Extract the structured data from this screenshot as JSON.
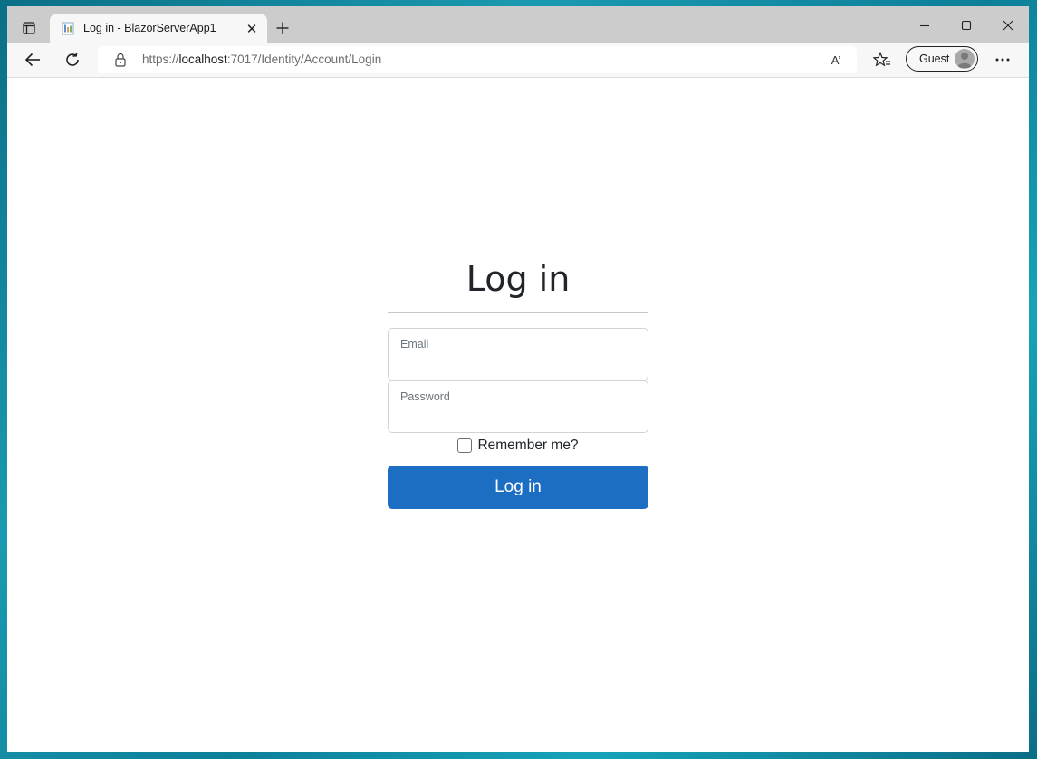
{
  "browser": {
    "tab_title": "Log in - BlazorServerApp1",
    "url_prefix": "https://",
    "url_host": "localhost",
    "url_rest": ":7017/Identity/Account/Login",
    "profile_label": "Guest",
    "tab_close_glyph": "✕",
    "readaloud_glyph": "A’"
  },
  "login": {
    "title": "Log in",
    "email_label": "Email",
    "password_label": "Password",
    "remember_label": "Remember me?",
    "submit_label": "Log in"
  },
  "colors": {
    "button": "#1b6ec2",
    "titlebar": "#cccccc",
    "toolbar": "#f7f7f7"
  },
  "icons": [
    "tab-actions-icon",
    "page-favicon-icon",
    "close-tab-icon",
    "new-tab-icon",
    "minimize-icon",
    "maximize-icon",
    "close-window-icon",
    "back-arrow-icon",
    "refresh-icon",
    "lock-icon",
    "read-aloud-icon",
    "favorites-icon",
    "guest-avatar-icon",
    "more-options-icon"
  ]
}
